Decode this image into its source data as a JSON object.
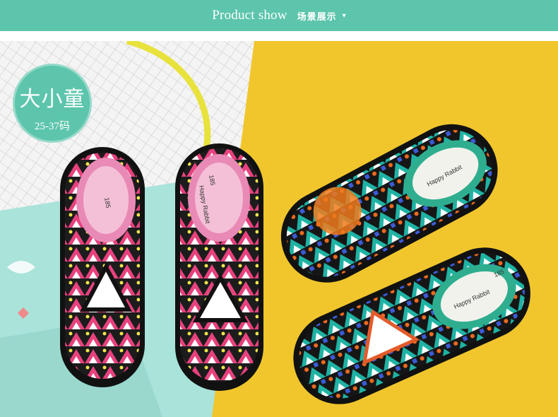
{
  "header": {
    "title_en": "Product show",
    "title_cn": "场景展示",
    "arrow": "▾"
  },
  "badge": {
    "title": "大小童",
    "size_range": "25-37码"
  },
  "photo": {
    "left_shoe_pair": {
      "insole_size": "185",
      "brand_text": "Happy Rabbit"
    },
    "right_shoe_pair": {
      "insole_size": "185",
      "brand_text": "Happy Rabbit"
    }
  }
}
